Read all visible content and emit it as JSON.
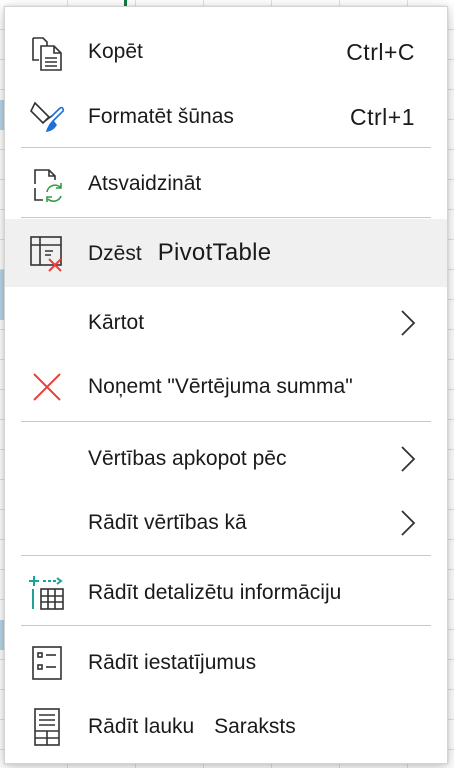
{
  "menu": {
    "copy": {
      "label": "Kopēt",
      "shortcut": "Ctrl+C",
      "icon": "copy-icon"
    },
    "format": {
      "label": "Formatēt šūnas",
      "shortcut": "Ctrl+1",
      "icon": "format-cells-icon"
    },
    "refresh": {
      "label": "Atsvaidzināt",
      "icon": "refresh-icon"
    },
    "delete": {
      "label": "Dzēst",
      "suffix": "PivotTable",
      "icon": "delete-pivottable-icon"
    },
    "sort": {
      "label": "Kārtot"
    },
    "remove": {
      "label": "Noņemt \"Vērtējuma summa\"",
      "icon": "remove-x-icon"
    },
    "summarize": {
      "label": "Vērtības apkopot pēc"
    },
    "show_values_as": {
      "label": "Rādīt vērtības kā"
    },
    "show_details": {
      "label": "Rādīt detalizētu informāciju",
      "icon": "show-details-icon"
    },
    "show_settings": {
      "label": "Rādīt iestatījumus",
      "icon": "settings-list-icon"
    },
    "show_field_list": {
      "label": "Rādīt lauku",
      "suffix": "Saraksts",
      "icon": "field-list-icon"
    }
  },
  "colors": {
    "accent_green": "#107c41",
    "remove_red": "#e8413c",
    "refresh_green": "#2f9e44",
    "details_teal": "#1aa39a"
  }
}
